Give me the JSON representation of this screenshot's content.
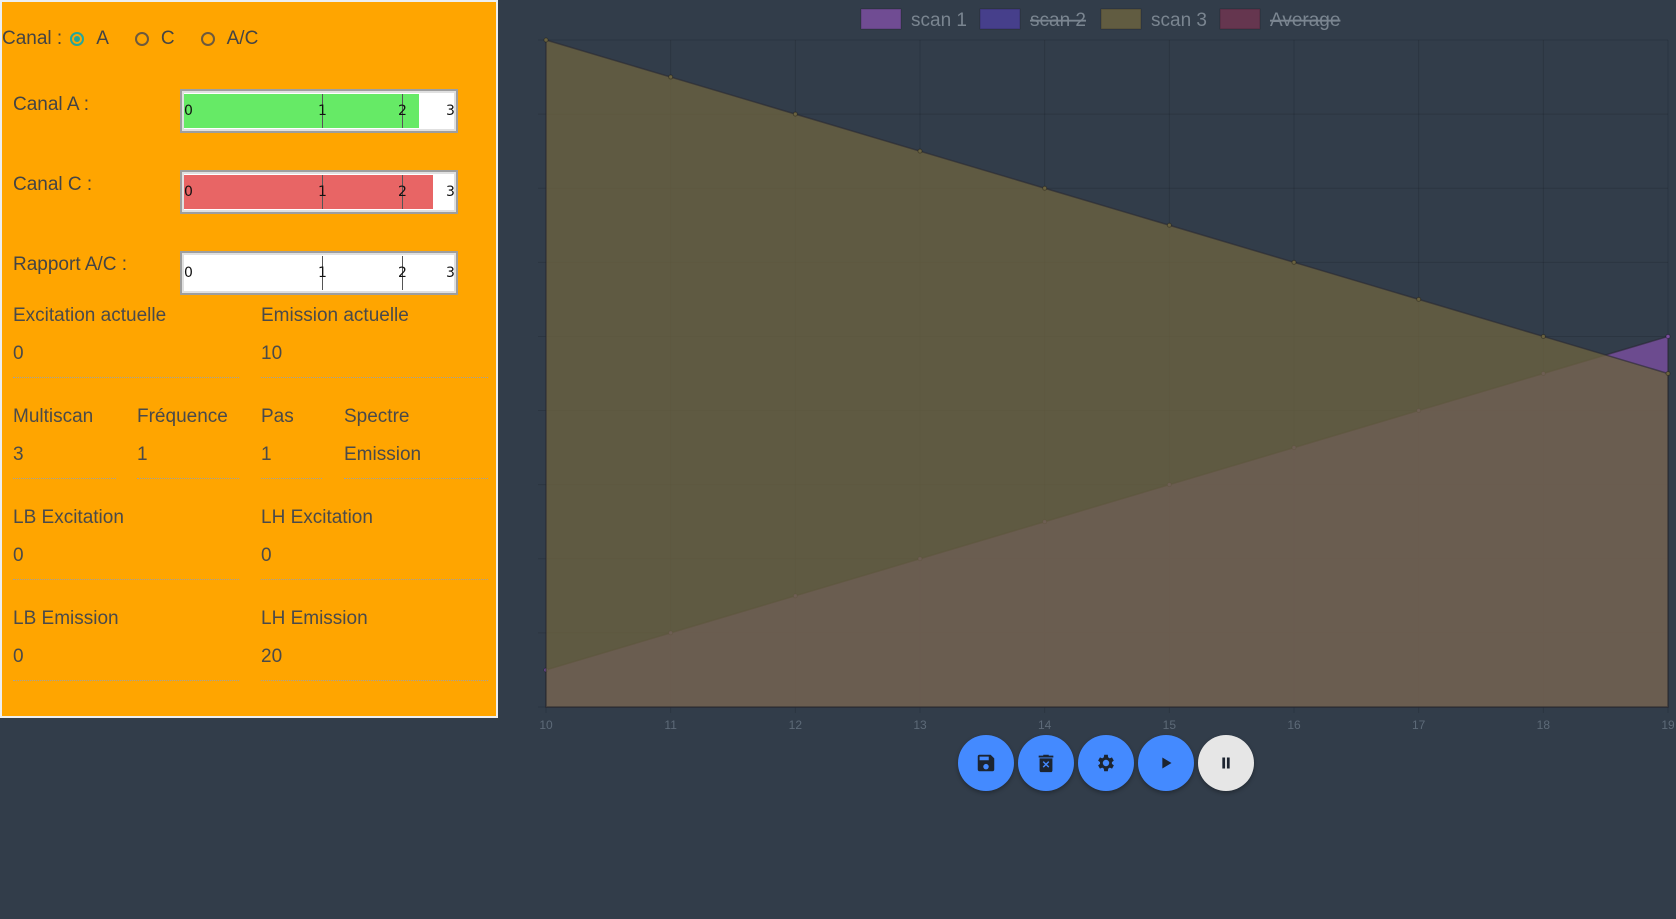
{
  "canal": {
    "label": "Canal :",
    "options": [
      "A",
      "C",
      "A/C"
    ],
    "selected": "A"
  },
  "meters": [
    {
      "label": "Canal A :",
      "value": 2.35,
      "max": 3,
      "color": "#66ea66",
      "ticks": [
        "0",
        "1",
        "2",
        "3"
      ]
    },
    {
      "label": "Canal C :",
      "value": 2.65,
      "max": 3,
      "color": "#e86565",
      "ticks": [
        "0",
        "1",
        "2",
        "3"
      ]
    },
    {
      "label": "Rapport A/C :",
      "value": 0,
      "max": 3,
      "color": "#ffffff",
      "ticks": [
        "0",
        "1",
        "2",
        "3"
      ]
    }
  ],
  "fields": {
    "excitation_actuelle": {
      "label": "Excitation actuelle",
      "value": "0"
    },
    "emission_actuelle": {
      "label": "Emission actuelle",
      "value": "10"
    },
    "multiscan": {
      "label": "Multiscan",
      "value": "3"
    },
    "frequence": {
      "label": "Fréquence",
      "value": "1"
    },
    "pas": {
      "label": "Pas",
      "value": "1"
    },
    "spectre": {
      "label": "Spectre",
      "value": "Emission"
    },
    "lb_excitation": {
      "label": "LB Excitation",
      "value": "0"
    },
    "lh_excitation": {
      "label": "LH Excitation",
      "value": "0"
    },
    "lb_emission": {
      "label": "LB Emission",
      "value": "0"
    },
    "lh_emission": {
      "label": "LH Emission",
      "value": "20"
    }
  },
  "chart_data": {
    "type": "area",
    "x": [
      10,
      11,
      12,
      13,
      14,
      15,
      16,
      17,
      18,
      19
    ],
    "xlim": [
      10,
      19
    ],
    "ylim": [
      0,
      18
    ],
    "grid": true,
    "legend_position": "top",
    "series": [
      {
        "name": "scan 1",
        "color": "#7b4fa0",
        "hidden": false,
        "values": [
          1,
          2,
          3,
          4,
          5,
          6,
          7,
          8,
          9,
          10
        ]
      },
      {
        "name": "scan 2",
        "color": "#4a3f96",
        "hidden": true,
        "values": []
      },
      {
        "name": "scan 3",
        "color": "#6a6240",
        "hidden": false,
        "values": [
          18,
          17,
          16,
          15,
          14,
          13,
          12,
          11,
          10,
          9
        ]
      },
      {
        "name": "Average",
        "color": "#6e3550",
        "hidden": true,
        "values": []
      }
    ]
  },
  "buttons": [
    {
      "name": "save-button",
      "icon": "save-icon"
    },
    {
      "name": "delete-button",
      "icon": "delete-icon"
    },
    {
      "name": "settings-button",
      "icon": "gear-icon"
    },
    {
      "name": "play-button",
      "icon": "play-icon"
    },
    {
      "name": "pause-button",
      "icon": "pause-icon"
    }
  ]
}
